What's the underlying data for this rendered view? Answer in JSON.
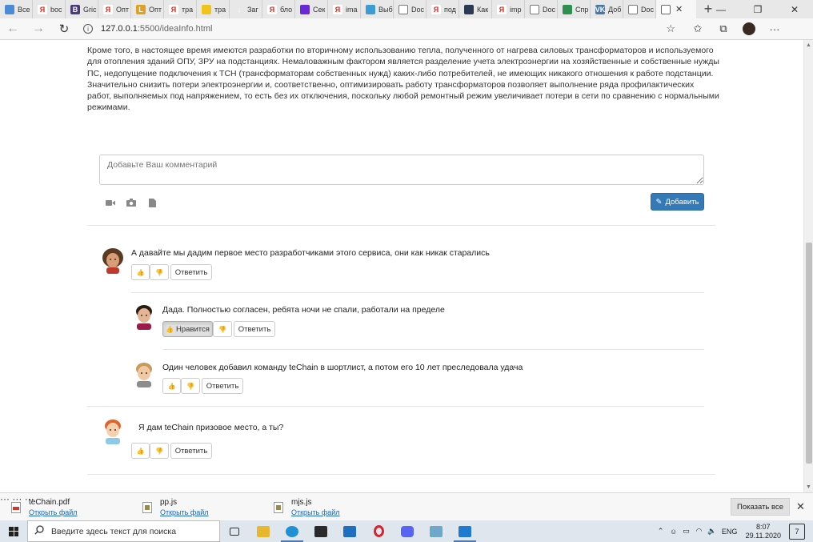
{
  "browser": {
    "tabs": [
      {
        "label": "Все",
        "fav_color": "#4a8ad9",
        "fav_text": ""
      },
      {
        "label": "boc",
        "fav_color": "#ffffff",
        "fav_text": "Я"
      },
      {
        "label": "Gric",
        "fav_color": "#4b3b7a",
        "fav_text": "B"
      },
      {
        "label": "Опт",
        "fav_color": "#ffffff",
        "fav_text": "Я"
      },
      {
        "label": "Опт",
        "fav_color": "#e0a020",
        "fav_text": "L"
      },
      {
        "label": "тра",
        "fav_color": "#ffffff",
        "fav_text": "Я"
      },
      {
        "label": "тра",
        "fav_color": "#f0c419",
        "fav_text": ""
      },
      {
        "label": "Заг",
        "fav_color": "#e8e8e8",
        "fav_text": "↓"
      },
      {
        "label": "бло",
        "fav_color": "#ffffff",
        "fav_text": "Я"
      },
      {
        "label": "Сек",
        "fav_color": "#6a28d9",
        "fav_text": ""
      },
      {
        "label": "ima",
        "fav_color": "#ffffff",
        "fav_text": "Я"
      },
      {
        "label": "Выб",
        "fav_color": "#3d9bd6",
        "fav_text": ""
      },
      {
        "label": "Doc",
        "fav_color": "#ffffff",
        "fav_text": ""
      },
      {
        "label": "под",
        "fav_color": "#ffffff",
        "fav_text": "Я"
      },
      {
        "label": "Как",
        "fav_color": "#2b3a55",
        "fav_text": ""
      },
      {
        "label": "imp",
        "fav_color": "#ffffff",
        "fav_text": "Я"
      },
      {
        "label": "Doc",
        "fav_color": "#ffffff",
        "fav_text": ""
      },
      {
        "label": "Спр",
        "fav_color": "#2f8f4e",
        "fav_text": ""
      },
      {
        "label": "Доб",
        "fav_color": "#4a76a8",
        "fav_text": "VK"
      },
      {
        "label": "Doc",
        "fav_color": "#ffffff",
        "fav_text": ""
      }
    ],
    "active_tab_close": "✕",
    "new_tab": "+",
    "url_host": "127.0.0.1",
    "url_rest": ":5500/ideaInfo.html"
  },
  "idea": {
    "description": "Кроме того, в настоящее время имеются разработки по вторичному использованию тепла, полученного от нагрева силовых трансформаторов и используемого для отопления зданий ОПУ, ЗРУ на подстанциях. Немаловажным фактором является разделение учета электроэнергии на хозяйственные и собственные нужды ПС, недопущение подключения к ТСН (трансформаторам собственных нужд) каких-либо потребителей, не имеющих никакого отношения к работе подстанции. Значительно снизить потери электроэнергии и, соответственно, оптимизировать работу трансформаторов позволяет выполнение ряда профилактических работ, выполняемых под напряжением, то есть без их отключения, поскольку любой ремонтный режим увеличивает потери в сети по сравнению с нормальными режимами."
  },
  "comment_form": {
    "placeholder": "Добавьте Ваш комментарий",
    "add_label": "Добавить"
  },
  "comments": [
    {
      "text": "А давайте мы дадим первое место разработчиками этого сервиса, они как никак старались",
      "reply_label": "Ответить"
    },
    {
      "text": "Дада. Полностью согласен, ребята ночи не спали, работали на пределе",
      "like_label": "Нравится",
      "reply_label": "Ответить"
    },
    {
      "text": "Один человек добавил команду teChain в шортлист, а потом его 10 лет преследовала удача",
      "reply_label": "Ответить"
    },
    {
      "text": "Я дам teChain призовое место, а ты?",
      "reply_label": "Ответить"
    }
  ],
  "downloads": {
    "items": [
      {
        "name": "teChain.pdf",
        "action": "Открыть файл"
      },
      {
        "name": "pp.js",
        "action": "Открыть файл"
      },
      {
        "name": "mjs.js",
        "action": "Открыть файл"
      }
    ],
    "more": "···",
    "show_all": "Показать все",
    "close": "✕"
  },
  "taskbar": {
    "search_placeholder": "Введите здесь текст для поиска",
    "lang": "ENG",
    "time": "8:07",
    "date": "29.11.2020",
    "notifications": "7"
  }
}
